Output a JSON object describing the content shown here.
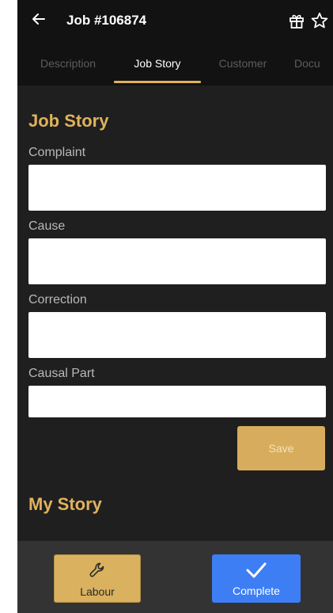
{
  "app_bar": {
    "title": "Job #106874",
    "back_icon": "arrow-left-icon",
    "gift_icon": "gift-icon",
    "star_icon": "star-outline-icon"
  },
  "tabs": [
    {
      "label": "Description",
      "active": false
    },
    {
      "label": "Job Story",
      "active": true
    },
    {
      "label": "Customer",
      "active": false
    },
    {
      "label": "Docu",
      "active": false
    }
  ],
  "job_story": {
    "title": "Job Story",
    "fields": [
      {
        "label": "Complaint",
        "value": ""
      },
      {
        "label": "Cause",
        "value": ""
      },
      {
        "label": "Correction",
        "value": ""
      },
      {
        "label": "Causal Part",
        "value": ""
      }
    ],
    "save_label": "Save"
  },
  "my_story": {
    "title": "My Story"
  },
  "bottom_bar": {
    "labour_label": "Labour",
    "labour_icon": "wrench-icon",
    "complete_label": "Complete",
    "complete_icon": "checkmark-icon"
  },
  "colors": {
    "accent": "#e0b25c",
    "primary": "#3d7ef5",
    "background": "#1f1f1f",
    "app_bar": "#121212"
  }
}
